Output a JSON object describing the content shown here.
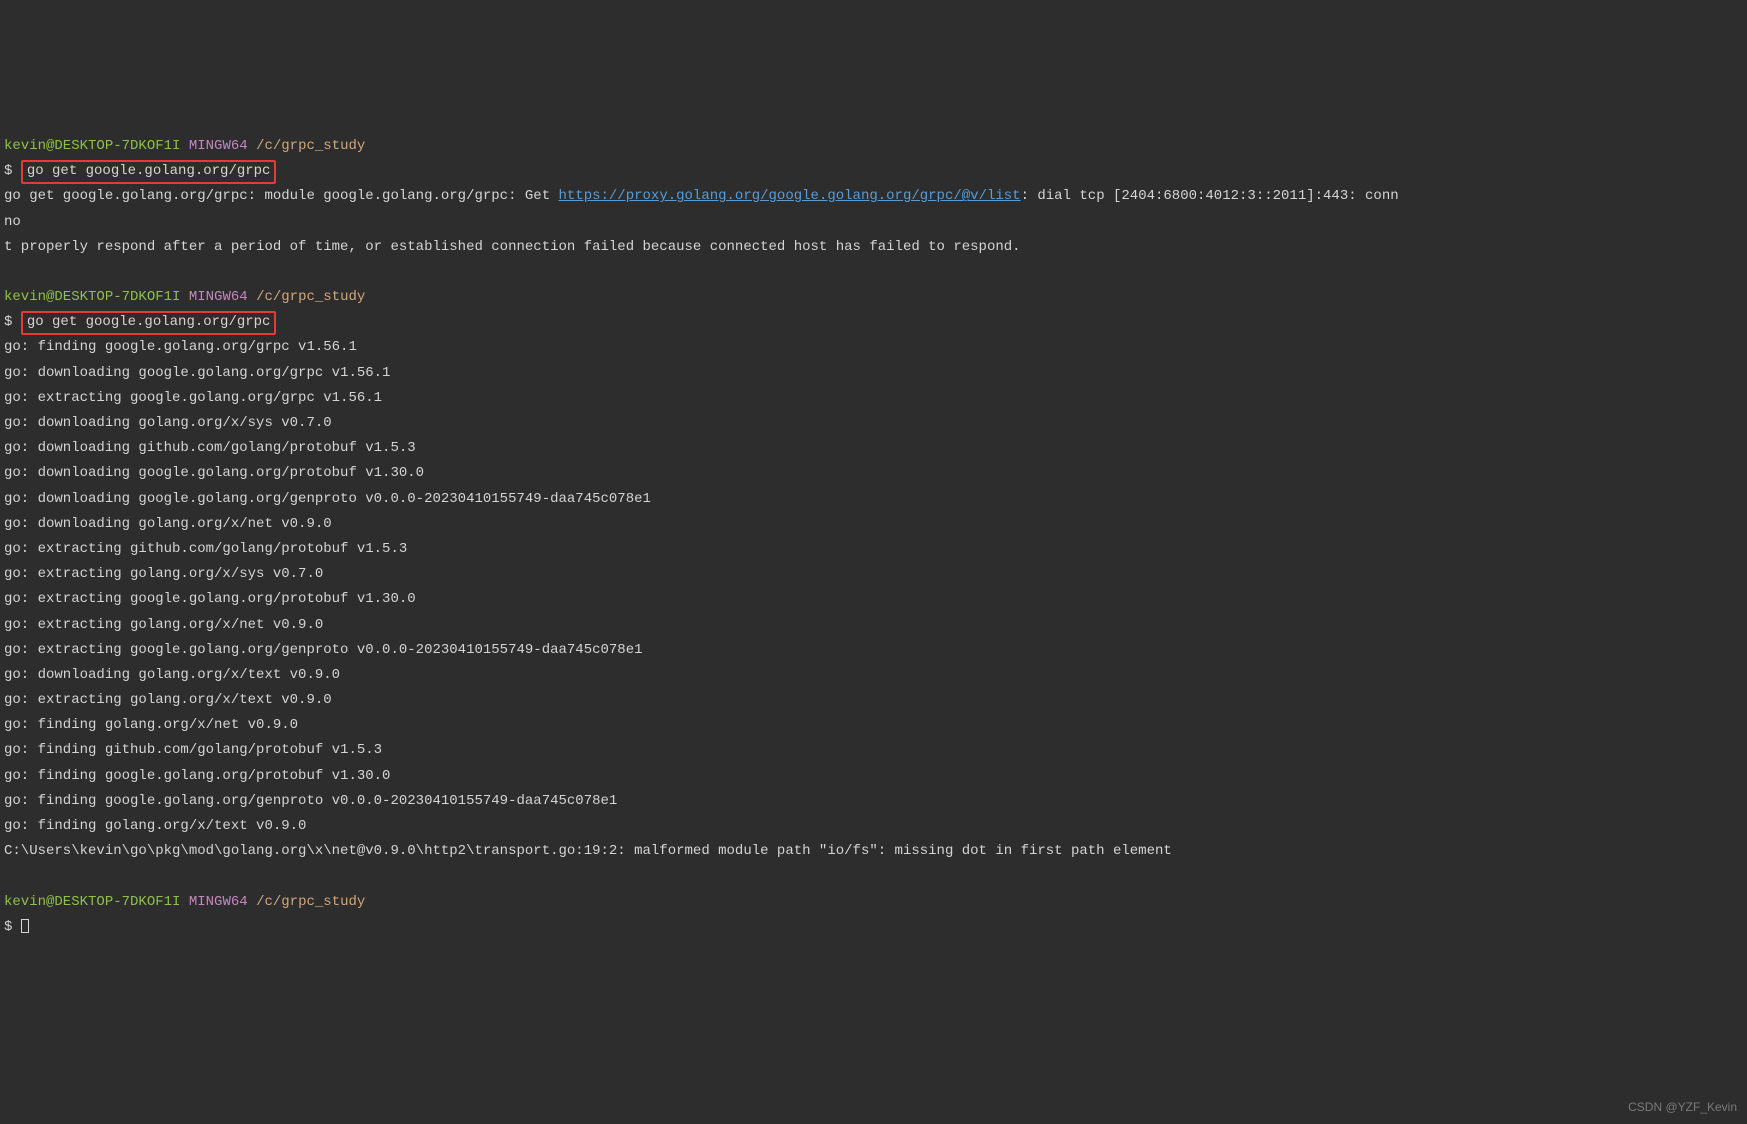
{
  "prompt1": {
    "user": "kevin@DESKTOP-7DKOF1I",
    "mingw": "MINGW64",
    "path": "/c/grpc_study",
    "dollar": "$",
    "command": "go get google.golang.org/grpc"
  },
  "error1": {
    "prefix": "go get google.golang.org/grpc: module google.golang.org/grpc: Get ",
    "url": "https://proxy.golang.org/google.golang.org/grpc/@v/list",
    "suffix1": ": dial tcp [2404:6800:4012:3::2011]:443: conn",
    "line2": "no",
    "line3": "t properly respond after a period of time, or established connection failed because connected host has failed to respond."
  },
  "prompt2": {
    "user": "kevin@DESKTOP-7DKOF1I",
    "mingw": "MINGW64",
    "path": "/c/grpc_study",
    "dollar": "$",
    "command": "go get google.golang.org/grpc"
  },
  "output": {
    "line1": "go: finding google.golang.org/grpc v1.56.1",
    "line2": "go: downloading google.golang.org/grpc v1.56.1",
    "line3": "go: extracting google.golang.org/grpc v1.56.1",
    "line4": "go: downloading golang.org/x/sys v0.7.0",
    "line5": "go: downloading github.com/golang/protobuf v1.5.3",
    "line6": "go: downloading google.golang.org/protobuf v1.30.0",
    "line7": "go: downloading google.golang.org/genproto v0.0.0-20230410155749-daa745c078e1",
    "line8": "go: downloading golang.org/x/net v0.9.0",
    "line9": "go: extracting github.com/golang/protobuf v1.5.3",
    "line10": "go: extracting golang.org/x/sys v0.7.0",
    "line11": "go: extracting google.golang.org/protobuf v1.30.0",
    "line12": "go: extracting golang.org/x/net v0.9.0",
    "line13": "go: extracting google.golang.org/genproto v0.0.0-20230410155749-daa745c078e1",
    "line14": "go: downloading golang.org/x/text v0.9.0",
    "line15": "go: extracting golang.org/x/text v0.9.0",
    "line16": "go: finding golang.org/x/net v0.9.0",
    "line17": "go: finding github.com/golang/protobuf v1.5.3",
    "line18": "go: finding google.golang.org/protobuf v1.30.0",
    "line19": "go: finding google.golang.org/genproto v0.0.0-20230410155749-daa745c078e1",
    "line20": "go: finding golang.org/x/text v0.9.0",
    "line21": "C:\\Users\\kevin\\go\\pkg\\mod\\golang.org\\x\\net@v0.9.0\\http2\\transport.go:19:2: malformed module path \"io/fs\": missing dot in first path element"
  },
  "prompt3": {
    "user": "kevin@DESKTOP-7DKOF1I",
    "mingw": "MINGW64",
    "path": "/c/grpc_study",
    "dollar": "$"
  },
  "watermark": "CSDN @YZF_Kevin"
}
